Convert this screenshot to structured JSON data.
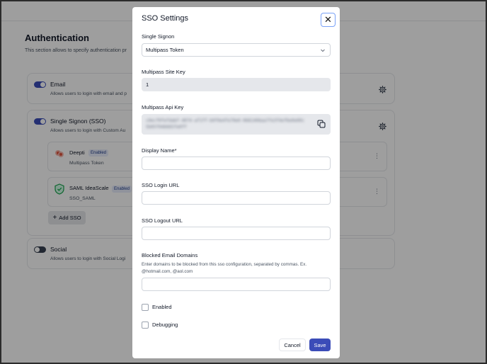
{
  "background": {
    "title": "Authentication",
    "description": "This section allows to specify authentication pr",
    "email": {
      "title": "Email",
      "description": "Allows users to login with email and p",
      "enabled": true
    },
    "sso": {
      "title": "Single Signon (SSO)",
      "description": "Allows users to login with Custom Au",
      "enabled": true,
      "providers": [
        {
          "name": "Deepti",
          "badge": "Enabled",
          "type": "Multipass Token"
        },
        {
          "name": "SAML IdeaScale",
          "badge": "Enabled",
          "type": "SSO_SAML"
        }
      ],
      "add_label": "Add SSO"
    },
    "social": {
      "title": "Social",
      "description": "Allows users to login with Social Logi",
      "enabled": false
    }
  },
  "modal": {
    "title": "SSO Settings",
    "single_signon": {
      "label": "Single Signon",
      "value": "Multipass Token"
    },
    "site_key": {
      "label": "Multipass Site Key",
      "value": "1"
    },
    "api_key": {
      "label": "Multipass Api Key",
      "value": "c0ecf0fefdabf-4074-af1ff-b0f0e4fe70e0-0681406aa7fe3f4ef6e0e00c5b05f046665fe0ff"
    },
    "display_name": {
      "label": "Display Name*",
      "value": ""
    },
    "login_url": {
      "label": "SSO Login URL",
      "value": ""
    },
    "logout_url": {
      "label": "SSO Logout URL",
      "value": ""
    },
    "blocked_domains": {
      "label": "Blocked Email Domains",
      "help": "Enter domains to be blocked from this sso configuration, separated by commas. Ex. @hotmail.com, @aol.com",
      "value": ""
    },
    "enabled": {
      "label": "Enabled",
      "checked": false
    },
    "debugging": {
      "label": "Debugging",
      "checked": false
    },
    "cancel_label": "Cancel",
    "save_label": "Save",
    "close_label": "✕"
  },
  "colors": {
    "accent": "#3b4cb8",
    "overlay": "rgba(0,0,0,0.38)"
  }
}
